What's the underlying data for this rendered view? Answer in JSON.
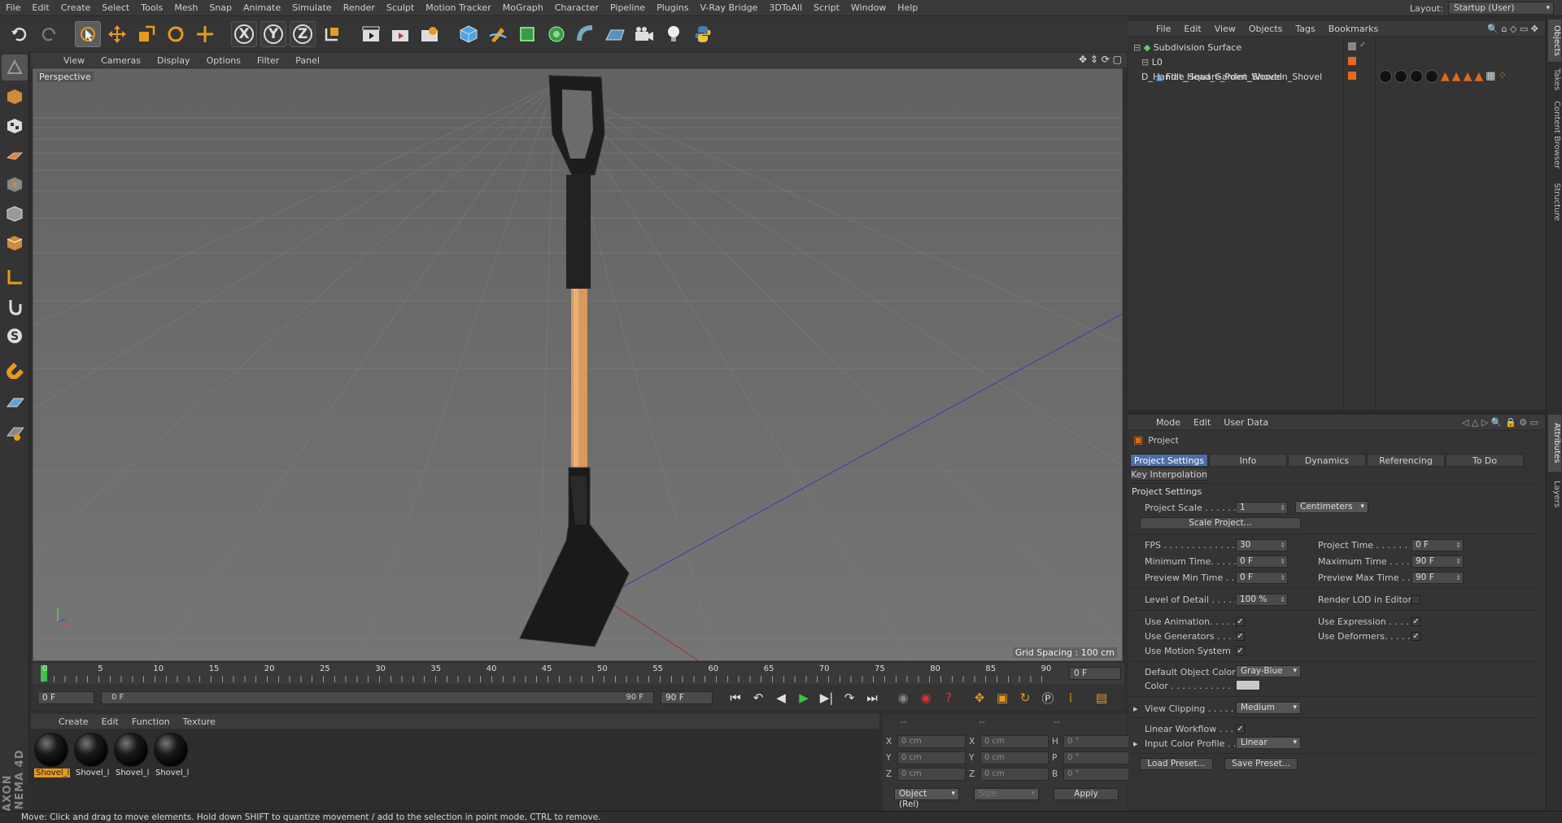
{
  "menubar": {
    "items": [
      "File",
      "Edit",
      "Create",
      "Select",
      "Tools",
      "Mesh",
      "Snap",
      "Animate",
      "Simulate",
      "Render",
      "Sculpt",
      "Motion Tracker",
      "MoGraph",
      "Character",
      "Pipeline",
      "Plugins",
      "V-Ray Bridge",
      "3DToAll",
      "Script",
      "Window",
      "Help"
    ],
    "layout_label": "Layout:",
    "layout_value": "Startup (User)"
  },
  "toolbar": {
    "axis_x": "X",
    "axis_y": "Y",
    "axis_z": "Z"
  },
  "viewport": {
    "menu": [
      "View",
      "Cameras",
      "Display",
      "Options",
      "Filter",
      "Panel"
    ],
    "camera_label": "Perspective",
    "grid_spacing": "Grid Spacing : 100 cm"
  },
  "timeline": {
    "ticks": [
      "0",
      "5",
      "10",
      "15",
      "20",
      "25",
      "30",
      "35",
      "40",
      "45",
      "50",
      "55",
      "60",
      "65",
      "70",
      "75",
      "80",
      "85",
      "90"
    ],
    "current_frame": "0 F",
    "start_field": "0 F",
    "range_start": "0 F",
    "range_end": "90 F",
    "end_field": "90 F"
  },
  "material_manager": {
    "menu": [
      "Create",
      "Edit",
      "Function",
      "Texture"
    ],
    "materials": [
      "Shovel_l",
      "Shovel_l",
      "Shovel_l",
      "Shovel_l"
    ]
  },
  "coordinates": {
    "header_a": "--",
    "header_b": "--",
    "header_c": "--",
    "rows": [
      {
        "a": "X",
        "av": "0 cm",
        "b": "X",
        "bv": "0 cm",
        "c": "H",
        "cv": "0 °"
      },
      {
        "a": "Y",
        "av": "0 cm",
        "b": "Y",
        "bv": "0 cm",
        "c": "P",
        "cv": "0 °"
      },
      {
        "a": "Z",
        "av": "0 cm",
        "b": "Z",
        "bv": "0 cm",
        "c": "B",
        "cv": "0 °"
      }
    ],
    "mode": "Object (Rel)",
    "size_mode": "Size",
    "apply": "Apply"
  },
  "status": "Move: Click and drag to move elements. Hold down SHIFT to quantize movement / add to the selection in point mode, CTRL to remove.",
  "object_manager": {
    "menu": [
      "File",
      "Edit",
      "View",
      "Objects",
      "Tags",
      "Bookmarks"
    ],
    "objects": [
      {
        "name": "Subdivision Surface"
      },
      {
        "name": "D_Handle_Square_Point_Wooden_Shovel"
      },
      {
        "name": "Flat_Head_Garden_Shovel"
      }
    ]
  },
  "attribute_manager": {
    "menu": [
      "Mode",
      "Edit",
      "User Data"
    ],
    "title": "Project",
    "tabs": [
      "Project Settings",
      "Info",
      "Dynamics",
      "Referencing",
      "To Do"
    ],
    "tab_row2": "Key Interpolation",
    "section": "Project Settings",
    "project_scale_label": "Project Scale . . . . . .",
    "project_scale_value": "1",
    "project_scale_unit": "Centimeters",
    "scale_project_button": "Scale Project...",
    "fps_label": "FPS . . . . . . . . . . . . .",
    "fps_value": "30",
    "project_time_label": "Project Time . . . . . . .",
    "project_time_value": "0 F",
    "min_time_label": "Minimum Time. . . . .",
    "min_time_value": "0 F",
    "max_time_label": "Maximum Time . . . . .",
    "max_time_value": "90 F",
    "prev_min_label": "Preview Min Time . .",
    "prev_min_value": "0 F",
    "prev_max_label": "Preview Max Time . .",
    "prev_max_value": "90 F",
    "lod_label": "Level of Detail . . . . .",
    "lod_value": "100 %",
    "render_lod_label": "Render LOD in Editor",
    "use_animation_label": "Use Animation. . . . .",
    "use_expression_label": "Use Expression . . . . .",
    "use_generators_label": "Use Generators . . . .",
    "use_deformers_label": "Use Deformers. . . . .",
    "use_motion_label": "Use Motion System",
    "default_color_label": "Default Object Color",
    "default_color_value": "Gray-Blue",
    "color_label": "Color . . . . . . . . . . .",
    "view_clipping_label": "View Clipping . . . . .",
    "view_clipping_value": "Medium",
    "linear_workflow_label": "Linear Workflow . . .",
    "input_color_label": "Input Color Profile . .",
    "input_color_value": "Linear",
    "load_preset": "Load Preset...",
    "save_preset": "Save Preset..."
  },
  "side_tabs": [
    "Objects",
    "Takes",
    "Content Browser",
    "Structure",
    "Attributes",
    "Layers"
  ],
  "logo": "MAXON CINEMA 4D",
  "colors": {
    "accent": "#e89a1c",
    "tab_active": "#4b6fa5",
    "handle_wood": "#d9995a"
  }
}
